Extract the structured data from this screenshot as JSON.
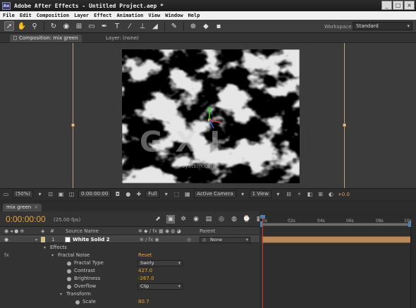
{
  "window": {
    "app_icon_label": "Ae",
    "title": "Adobe After Effects - Untitled Project.aep *",
    "buttons": {
      "minimize": "_",
      "maximize": "□",
      "close": "×"
    }
  },
  "menu": [
    "File",
    "Edit",
    "Composition",
    "Layer",
    "Effect",
    "Animation",
    "View",
    "Window",
    "Help"
  ],
  "toolbar": {
    "tools": [
      "selection-tool",
      "hand-tool",
      "zoom-tool",
      "rotation-tool",
      "orbit-camera-tool",
      "pan-behind-tool",
      "rectangle-mask-tool",
      "pen-tool",
      "type-tool",
      "brush-tool",
      "clone-stamp-tool",
      "eraser-tool",
      "puppet-pin-tool"
    ],
    "workspace_label": "Workspace:",
    "workspace_value": "Standard"
  },
  "panels": {
    "composition_tab": "Composition: mix green",
    "layer_tab": "Layer: (none)"
  },
  "viewer_footer": {
    "zoom": "(50%)",
    "timecode": "0:00:00:00",
    "resolution": "Full",
    "camera": "Active Camera",
    "views": "1 View",
    "exposure": "+0.0"
  },
  "timeline": {
    "tab": "mix green",
    "timecode": "0:00:00:00",
    "fps": "(25.00 fps)",
    "ruler_ticks": [
      "0s",
      "02s",
      "04s",
      "06s",
      "08s",
      "10s"
    ],
    "columns": {
      "number": "#",
      "source_name": "Source Name",
      "parent": "Parent"
    },
    "layer": {
      "index": "1",
      "name": "White Solid 2",
      "parent": "None"
    },
    "properties": {
      "effects": "Effects",
      "fractal_noise": "Fractal Noise",
      "reset": "Reset",
      "fractal_type_label": "Fractal Type",
      "fractal_type_value": "Swirly",
      "contrast_label": "Contrast",
      "contrast_value": "427.0",
      "brightness_label": "Brightness",
      "brightness_value": "-267.0",
      "overflow_label": "Overflow",
      "overflow_value": "Clip",
      "transform_label": "Transform",
      "scale_label": "Scale",
      "scale_value": "80.7"
    }
  },
  "watermark": {
    "text": "G X I",
    "sub": "system.com"
  },
  "colors": {
    "accent": "#e8a33a",
    "playhead": "#d63b2a",
    "layer_bar": "#b8875a",
    "guides": "#d9b48a"
  }
}
